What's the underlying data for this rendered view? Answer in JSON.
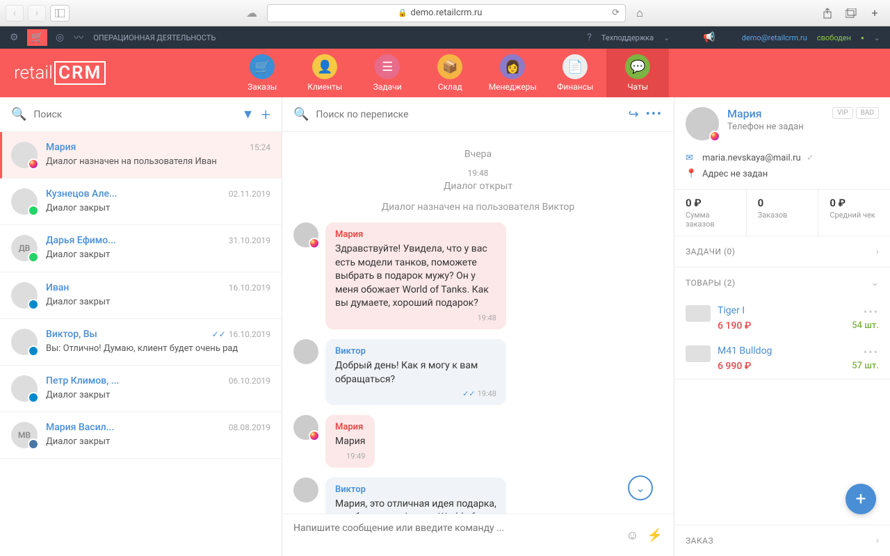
{
  "browser": {
    "url": "demo.retailcrm.ru"
  },
  "darkbar": {
    "op_text": "ОПЕРАЦИОННАЯ ДЕЯТЕЛЬНОСТЬ",
    "support": "Техподдержка",
    "email": "demo@retailcrm.ru",
    "status": "свободен"
  },
  "nav": {
    "logo_a": "retail",
    "logo_b": "CRM",
    "items": [
      "Заказы",
      "Клиенты",
      "Задачи",
      "Склад",
      "Менеджеры",
      "Финансы",
      "Чаты"
    ]
  },
  "search": {
    "placeholder": "Поиск",
    "convo_placeholder": "Поиск по переписке",
    "compose_placeholder": "Напишите сообщение или введите команду ..."
  },
  "chats": [
    {
      "name": "Мария",
      "date": "15:24",
      "preview": "Диалог назначен на пользователя Иван",
      "badge": "ig",
      "active": true,
      "initials": ""
    },
    {
      "name": "Кузнецов Але...",
      "date": "02.11.2019",
      "preview": "Диалог закрыт",
      "badge": "wa",
      "initials": ""
    },
    {
      "name": "Дарья Ефимо...",
      "date": "31.10.2019",
      "preview": "Диалог закрыт",
      "badge": "wa",
      "initials": "ДВ"
    },
    {
      "name": "Иван",
      "date": "16.10.2019",
      "preview": "Диалог закрыт",
      "badge": "tg",
      "initials": ""
    },
    {
      "name": "Виктор, Вы",
      "date": "16.10.2019",
      "preview": "Вы: Отлично! Думаю, клиент будет очень рад",
      "badge": "tg",
      "initials": "",
      "tick": true
    },
    {
      "name": "Петр Климов, ...",
      "date": "06.10.2019",
      "preview": "Диалог закрыт",
      "badge": "tg",
      "initials": ""
    },
    {
      "name": "Мария Васил...",
      "date": "08.08.2019",
      "preview": "Диалог закрыт",
      "badge": "vk",
      "initials": "МВ"
    }
  ],
  "convo": {
    "date_sep": "Вчера",
    "sys": [
      {
        "time": "19:48",
        "text": "Диалог открыт"
      },
      {
        "text": "Диалог назначен на пользователя Виктор"
      }
    ],
    "messages": [
      {
        "who": "customer",
        "name": "Мария",
        "text": "Здравствуйте! Увидела, что у вас есть модели танков, поможете выбрать в подарок мужу? Он у меня обожает World of Tanks. Как вы думаете, хороший подарок?",
        "time": "19:48"
      },
      {
        "who": "agent",
        "name": "Виктор",
        "text": "Добрый день! Как я могу к вам обращаться?",
        "time": "19:48",
        "read": true
      },
      {
        "who": "customer",
        "name": "Мария",
        "text": "Мария",
        "time": "19:49"
      },
      {
        "who": "agent",
        "name": "Виктор",
        "text": "Мария, это отличная идея подарка, тем более для фаната World of",
        "time": ""
      }
    ]
  },
  "client": {
    "name": "Мария",
    "phone": "Телефон не задан",
    "email": "maria.nevskaya@mail.ru",
    "address": "Адрес не задан",
    "tags": [
      "VIP",
      "BAD"
    ],
    "stats": [
      {
        "val": "0 ₽",
        "label": "Сумма заказов"
      },
      {
        "val": "0",
        "label": "Заказов"
      },
      {
        "val": "0 ₽",
        "label": "Средний чек"
      }
    ],
    "tasks_title": "ЗАДАЧИ (0)",
    "products_title": "ТОВАРЫ (2)",
    "products": [
      {
        "name": "Tiger I",
        "price": "6 190 ₽",
        "qty": "54 шт."
      },
      {
        "name": "M41 Bulldog",
        "price": "6 990 ₽",
        "qty": "57 шт."
      }
    ],
    "order_title": "ЗАКАЗ"
  }
}
